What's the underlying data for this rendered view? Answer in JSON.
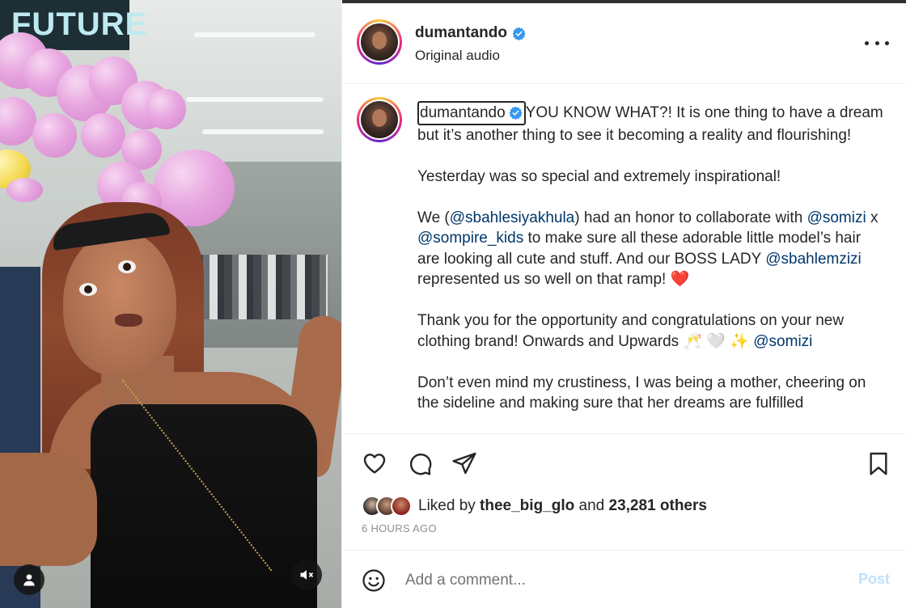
{
  "media": {
    "sign_text": "FUTURE",
    "icons": {
      "profile": "person-icon",
      "mute": "speaker-muted-icon"
    }
  },
  "post": {
    "username": "dumantando",
    "subtitle": "Original audio",
    "caption": {
      "p1_rest": "YOU KNOW WHAT?! It is one thing to have a dream but it’s another thing to see it becoming a reality and flourishing!",
      "p2": "Yesterday was so special and extremely inspirational!",
      "p3_a": "We (",
      "p3_m1": "@sbahlesiyakhula",
      "p3_b": ") had an honor to collaborate with ",
      "p3_m2": "@somizi",
      "p3_c": " x ",
      "p3_m3": "@sompire_kids",
      "p3_d": " to make sure all these adorable little model’s hair are looking all cute and stuff. And our BOSS LADY ",
      "p3_m4": "@sbahlemzizi",
      "p3_e": " represented us so well on that ramp! ",
      "p3_heart": "❤️",
      "p4_a": "Thank you for the opportunity and congratulations on your new clothing brand! Onwards and Upwards 🥂 🤍 ✨ ",
      "p4_m1": "@somizi",
      "p5": "Don’t even mind my crustiness, I was being a mother, cheering on the sideline and making sure that her dreams are fulfilled"
    },
    "likes": {
      "prefix": "Liked by ",
      "user": "thee_big_glo",
      "middle": " and ",
      "count": "23,281 others"
    },
    "time": "6 HOURS AGO",
    "comment": {
      "placeholder": "Add a comment...",
      "post_label": "Post"
    },
    "icons": {
      "like": "heart-icon",
      "comment": "comment-bubble-icon",
      "share": "paper-plane-icon",
      "save": "bookmark-icon",
      "emoji": "smiley-icon",
      "more": "more-options-icon",
      "verified": "verified-badge-icon"
    },
    "colors": {
      "link": "#00376b",
      "verified": "#3897f0",
      "post_disabled": "#c0dffd"
    }
  }
}
